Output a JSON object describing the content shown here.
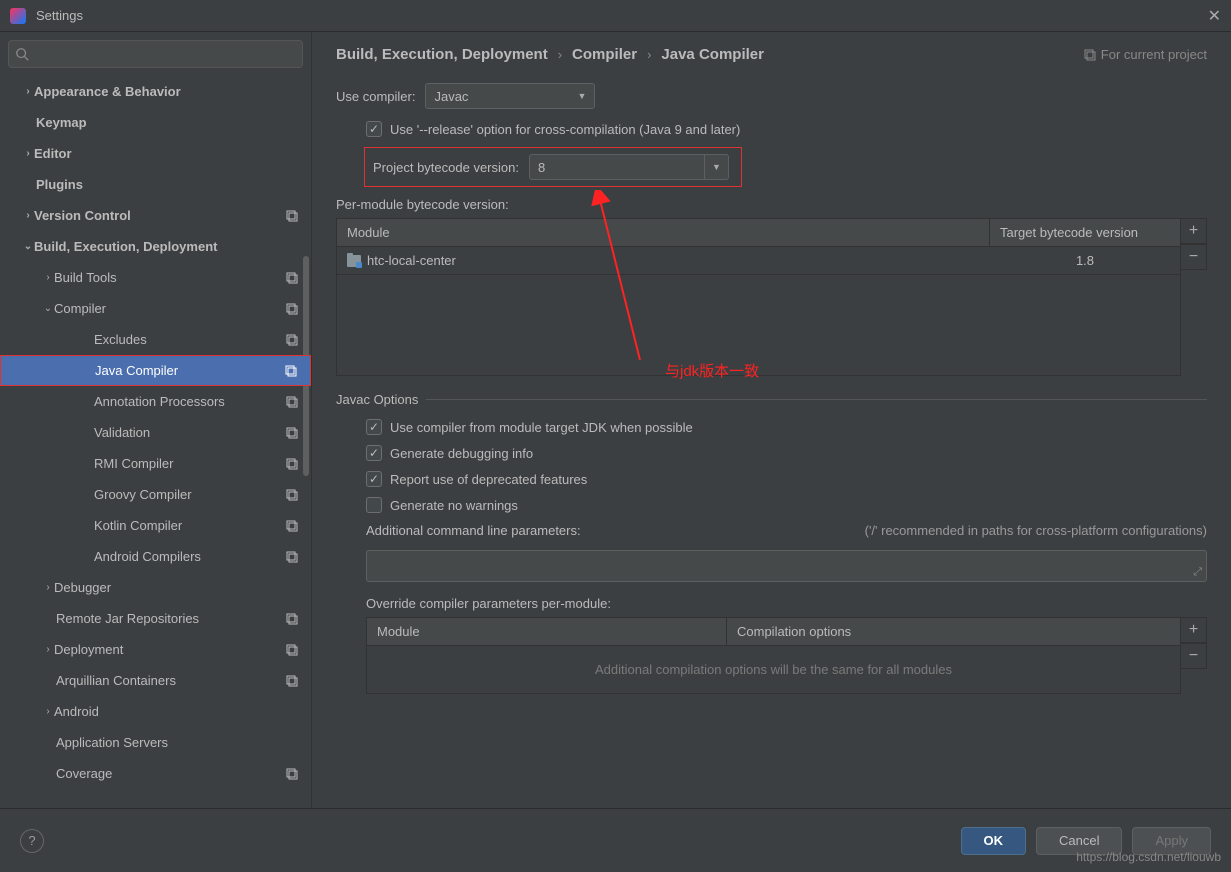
{
  "window": {
    "title": "Settings"
  },
  "sidebar": {
    "items": [
      {
        "label": "Appearance & Behavior",
        "bold": true,
        "arrow": "›",
        "pad": 0
      },
      {
        "label": "Keymap",
        "bold": true,
        "pad": 0
      },
      {
        "label": "Editor",
        "bold": true,
        "arrow": "›",
        "pad": 0
      },
      {
        "label": "Plugins",
        "bold": true,
        "pad": 0
      },
      {
        "label": "Version Control",
        "bold": true,
        "arrow": "›",
        "pad": 0,
        "badge": true
      },
      {
        "label": "Build, Execution, Deployment",
        "bold": true,
        "arrow": "⌄",
        "pad": 0
      },
      {
        "label": "Build Tools",
        "arrow": "›",
        "pad": 1,
        "badge": true
      },
      {
        "label": "Compiler",
        "arrow": "⌄",
        "pad": 1,
        "badge": true
      },
      {
        "label": "Excludes",
        "pad": 3,
        "badge": true
      },
      {
        "label": "Java Compiler",
        "pad": 3,
        "badge": true,
        "selected": true
      },
      {
        "label": "Annotation Processors",
        "pad": 3,
        "badge": true
      },
      {
        "label": "Validation",
        "pad": 3,
        "badge": true
      },
      {
        "label": "RMI Compiler",
        "pad": 3,
        "badge": true
      },
      {
        "label": "Groovy Compiler",
        "pad": 3,
        "badge": true
      },
      {
        "label": "Kotlin Compiler",
        "pad": 3,
        "badge": true
      },
      {
        "label": "Android Compilers",
        "pad": 3,
        "badge": true
      },
      {
        "label": "Debugger",
        "arrow": "›",
        "pad": 1
      },
      {
        "label": "Remote Jar Repositories",
        "pad": 1,
        "badge": true
      },
      {
        "label": "Deployment",
        "arrow": "›",
        "pad": 1,
        "badge": true
      },
      {
        "label": "Arquillian Containers",
        "pad": 1,
        "badge": true
      },
      {
        "label": "Android",
        "arrow": "›",
        "pad": 1
      },
      {
        "label": "Application Servers",
        "pad": 1
      },
      {
        "label": "Coverage",
        "pad": 1,
        "badge": true
      }
    ]
  },
  "breadcrumb": [
    "Build, Execution, Deployment",
    "Compiler",
    "Java Compiler"
  ],
  "for_project": "For current project",
  "use_compiler_label": "Use compiler:",
  "use_compiler_value": "Javac",
  "release_option": "Use '--release' option for cross-compilation (Java 9 and later)",
  "project_bytecode_label": "Project bytecode version:",
  "project_bytecode_value": "8",
  "per_module_label": "Per-module bytecode version:",
  "module_table": {
    "cols": [
      "Module",
      "Target bytecode version"
    ],
    "rows": [
      {
        "module": "htc-local-center",
        "target": "1.8"
      }
    ]
  },
  "javac_section": "Javac Options",
  "opts": {
    "o1": "Use compiler from module target JDK when possible",
    "o2": "Generate debugging info",
    "o3": "Report use of deprecated features",
    "o4": "Generate no warnings"
  },
  "addl_params_label": "Additional command line parameters:",
  "addl_params_hint": "('/' recommended in paths for cross-platform configurations)",
  "override_label": "Override compiler parameters per-module:",
  "override_table": {
    "cols": [
      "Module",
      "Compilation options"
    ]
  },
  "override_empty": "Additional compilation options will be the same for all modules",
  "annotation": "与jdk版本一致",
  "buttons": {
    "ok": "OK",
    "cancel": "Cancel",
    "apply": "Apply"
  },
  "watermark": "https://blog.csdn.net/liouwb"
}
